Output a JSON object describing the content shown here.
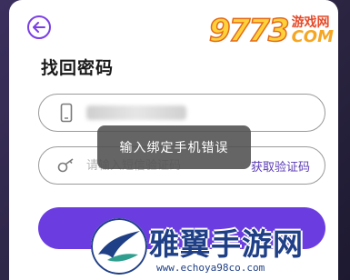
{
  "header": {
    "title": "找回密码"
  },
  "watermark_top": {
    "digits": "9773",
    "cn": "游戏网",
    "com": "COM"
  },
  "phone_field": {
    "value_redacted": true
  },
  "code_field": {
    "placeholder": "请输入短信验证码",
    "get_code_label": "获取验证码"
  },
  "toast": {
    "message": "输入绑定手机错误"
  },
  "watermark_bottom": {
    "text": "雅翼手游网",
    "url": "www.echoya98co.com"
  },
  "colors": {
    "accent": "#6b3de0",
    "link": "#5a3bb5",
    "toast_bg": "#505050"
  }
}
